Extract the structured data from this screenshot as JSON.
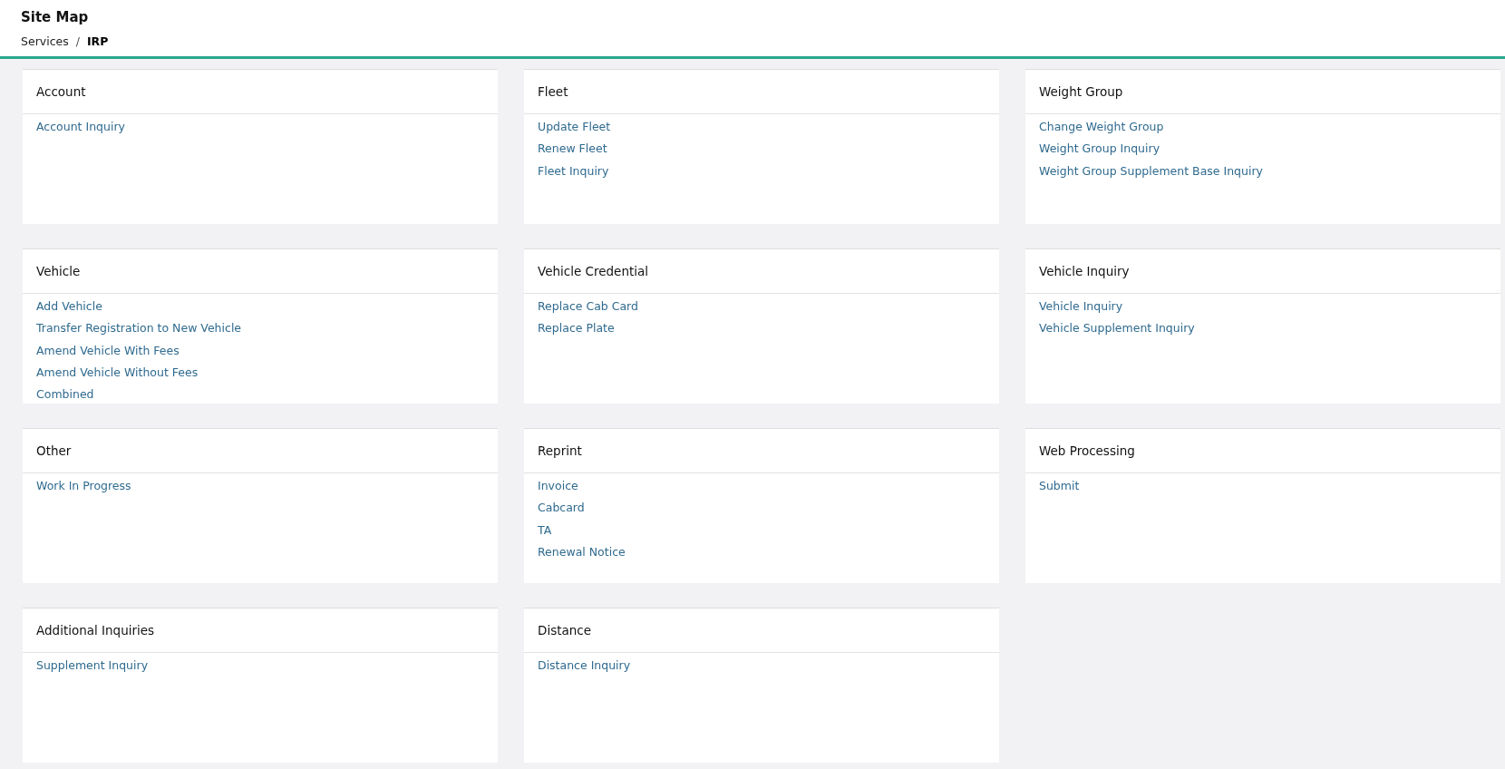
{
  "header": {
    "title": "Site Map",
    "separator": "/",
    "breadcrumb": [
      {
        "label": "Services",
        "current": false
      },
      {
        "label": "IRP",
        "current": true
      }
    ]
  },
  "cards": [
    {
      "title": "Account",
      "links": [
        "Account Inquiry"
      ]
    },
    {
      "title": "Fleet",
      "links": [
        "Update Fleet",
        "Renew Fleet",
        "Fleet Inquiry"
      ]
    },
    {
      "title": "Weight Group",
      "links": [
        "Change Weight Group",
        "Weight Group Inquiry",
        "Weight Group Supplement Base Inquiry"
      ]
    },
    {
      "title": "Vehicle",
      "links": [
        "Add Vehicle",
        "Transfer Registration to New Vehicle",
        "Amend Vehicle With Fees",
        "Amend Vehicle Without Fees",
        "Combined"
      ]
    },
    {
      "title": "Vehicle Credential",
      "links": [
        "Replace Cab Card",
        "Replace Plate"
      ]
    },
    {
      "title": "Vehicle Inquiry",
      "links": [
        "Vehicle Inquiry",
        "Vehicle Supplement Inquiry"
      ]
    },
    {
      "title": "Other",
      "links": [
        "Work In Progress"
      ]
    },
    {
      "title": "Reprint",
      "links": [
        "Invoice",
        "Cabcard",
        "TA",
        "Renewal Notice"
      ]
    },
    {
      "title": "Web Processing",
      "links": [
        "Submit"
      ]
    },
    {
      "title": "Additional Inquiries",
      "links": [
        "Supplement Inquiry"
      ]
    },
    {
      "title": "Distance",
      "links": [
        "Distance Inquiry"
      ]
    }
  ]
}
